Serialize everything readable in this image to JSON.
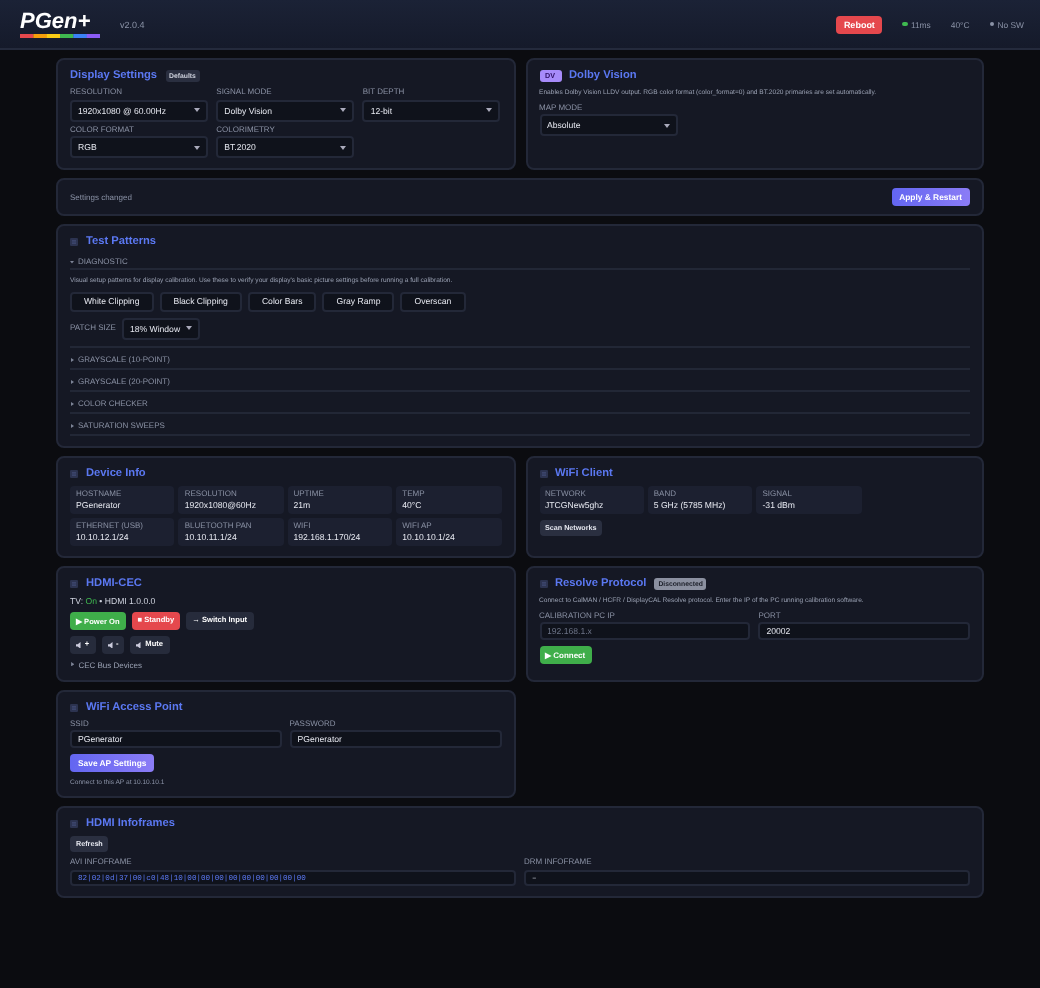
{
  "header": {
    "logo": "PGen+",
    "version": "v2.0.4",
    "reboot": "Reboot",
    "status": [
      {
        "text": "11ms",
        "color": "#3fb950"
      },
      {
        "text": "40°C"
      },
      {
        "text": "No SW",
        "color": "#8b93a7"
      }
    ]
  },
  "display_settings": {
    "title": "Display Settings",
    "badge": "Defaults",
    "fields": [
      {
        "label": "RESOLUTION",
        "value": "1920x1080 @ 60.00Hz"
      },
      {
        "label": "SIGNAL MODE",
        "value": "Dolby Vision"
      },
      {
        "label": "BIT DEPTH",
        "value": "12-bit"
      },
      {
        "label": "COLOR FORMAT",
        "value": "RGB"
      },
      {
        "label": "COLORIMETRY",
        "value": "BT.2020"
      }
    ]
  },
  "dolby_vision": {
    "badge": "DV",
    "title": "Dolby Vision",
    "description": "Enables Dolby Vision LLDV output. RGB color format (color_format=0) and BT.2020 primaries are set automatically.",
    "map_mode": {
      "label": "MAP MODE",
      "value": "Absolute"
    }
  },
  "apply_bar": {
    "message": "Settings changed",
    "button": "Apply & Restart"
  },
  "test_patterns": {
    "title": "Test Patterns",
    "sections": [
      {
        "label": "DIAGNOSTIC",
        "expanded": true
      },
      {
        "label": "GRAYSCALE (10-POINT)",
        "expanded": false
      },
      {
        "label": "GRAYSCALE (20-POINT)",
        "expanded": false
      },
      {
        "label": "COLOR CHECKER",
        "expanded": false
      },
      {
        "label": "SATURATION SWEEPS",
        "expanded": false
      }
    ],
    "description": "Visual setup patterns for display calibration. Use these to verify your display's basic picture settings before running a full calibration.",
    "buttons": [
      "White Clipping",
      "Black Clipping",
      "Color Bars",
      "Gray Ramp",
      "Overscan"
    ],
    "patch_size": {
      "label": "PATCH SIZE",
      "value": "18% Window"
    }
  },
  "device_info": {
    "title": "Device Info",
    "tiles": [
      {
        "label": "HOSTNAME",
        "value": "PGenerator"
      },
      {
        "label": "RESOLUTION",
        "value": "1920x1080@60Hz"
      },
      {
        "label": "UPTIME",
        "value": "21m"
      },
      {
        "label": "TEMP",
        "value": "40°C"
      },
      {
        "label": "ETHERNET (USB)",
        "value": "10.10.12.1/24"
      },
      {
        "label": "BLUETOOTH PAN",
        "value": "10.10.11.1/24"
      },
      {
        "label": "WIFI",
        "value": "192.168.1.170/24"
      },
      {
        "label": "WIFI AP",
        "value": "10.10.10.1/24"
      }
    ]
  },
  "wifi_client": {
    "title": "WiFi Client",
    "tiles": [
      {
        "label": "NETWORK",
        "value": "JTCGNew5ghz"
      },
      {
        "label": "BAND",
        "value": "5 GHz (5785 MHz)"
      },
      {
        "label": "SIGNAL",
        "value": "-31 dBm"
      }
    ],
    "button": "Scan Networks"
  },
  "hdmi_cec": {
    "title": "HDMI-CEC",
    "tv_label": "TV:",
    "tv_power": "On",
    "tv_address": "• HDMI 1.0.0.0",
    "buttons": [
      {
        "label": "▶ Power On",
        "kind": "green"
      },
      {
        "label": "■ Standby",
        "kind": "red"
      },
      {
        "label": "→ Switch Input",
        "kind": "plain"
      }
    ],
    "volume_buttons": [
      "+",
      "-",
      "Mute"
    ],
    "bus_devices": {
      "label": "CEC Bus Devices",
      "expanded": false
    }
  },
  "resolve": {
    "title": "Resolve Protocol",
    "status": "Disconnected",
    "description": "Connect to CalMAN / HCFR / DisplayCAL Resolve protocol. Enter the IP of the PC running calibration software.",
    "ip": {
      "label": "CALIBRATION PC IP",
      "placeholder": "192.168.1.x"
    },
    "port": {
      "label": "PORT",
      "value": "20002"
    },
    "button": "▶ Connect"
  },
  "wifi_ap": {
    "title": "WiFi Access Point",
    "ssid": {
      "label": "SSID",
      "value": "PGenerator"
    },
    "password": {
      "label": "PASSWORD",
      "value": "PGenerator"
    },
    "button": "Save AP Settings",
    "note": "Connect to this AP at 10.10.10.1"
  },
  "infoframes": {
    "title": "HDMI Infoframes",
    "button": "Refresh",
    "avi": {
      "label": "AVI INFOFRAME",
      "value": "82|02|0d|37|00|c0|48|10|00|00|00|00|00|00|00|00|00"
    },
    "drm": {
      "label": "DRM INFOFRAME",
      "value": "–"
    }
  }
}
